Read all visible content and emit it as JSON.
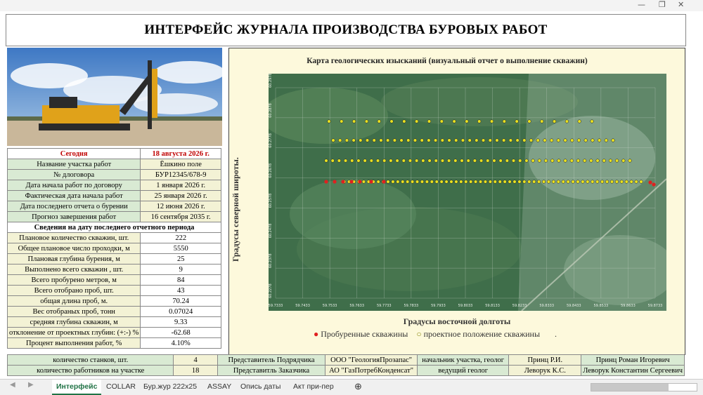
{
  "window": {
    "min": "—",
    "restore": "❐",
    "close": "✕"
  },
  "title": "ИНТЕРФЕЙС ЖУРНАЛА ПРОИЗВОДСТВА БУРОВЫХ РАБОТ",
  "info": {
    "today_label": "Сегодня",
    "today_value": "18 августа 2026 г.",
    "rows": [
      {
        "label": "Название участка работ",
        "value": "Ёшкино поле"
      },
      {
        "label": "№ длоговора",
        "value": "БУР12345/678-9"
      },
      {
        "label": "Дата начала работ по договору",
        "value": "1 января 2026 г."
      },
      {
        "label": "Фактическая дата начала работ",
        "value": "25 января 2026 г."
      },
      {
        "label": "Дата последнего отчета о  бурении",
        "value": "12 июня 2026 г."
      },
      {
        "label": "Прогноз завершения работ",
        "value": "16 сентября 2035 г."
      }
    ],
    "section": "Сведения на дату последнего отчетного периода",
    "stats": [
      {
        "label": "Плановое количество скважин, шт.",
        "value": "222"
      },
      {
        "label": "Общее плановое число проходки, м",
        "value": "5550"
      },
      {
        "label": "Плановая глубина бурения, м",
        "value": "25"
      },
      {
        "label": "Выполнено всего скважин , шт.",
        "value": "9"
      },
      {
        "label": "Всего пробурено метров, м",
        "value": "84"
      },
      {
        "label": "Всего отобрано проб, шт.",
        "value": "43"
      },
      {
        "label": "общая длина проб, м.",
        "value": "70.24"
      },
      {
        "label": "Вес отобраных проб, тонн",
        "value": "0.07024"
      },
      {
        "label": "средняя глубина скважин, м",
        "value": "9.33"
      },
      {
        "label": "отклонение от проектных глубин: (+:-) %",
        "value": "-62.68"
      },
      {
        "label": "Процент выполнения работ, %",
        "value": "4.10%"
      }
    ]
  },
  "map": {
    "title": "Карта геологических изысканий  (визуальный отчет о выполнение скважин)",
    "ylabel": "Градусы северной широты.",
    "xlabel": "Градусы восточной долготы",
    "legend_drilled": "Пробуренные скважины",
    "legend_project": "проектное положение скважины",
    "legend_extra": ".",
    "colors": {
      "drilled": "#e02020",
      "project": "#e8e020"
    }
  },
  "chart_data": {
    "type": "scatter",
    "xlabel": "Градусы восточной долготы",
    "ylabel": "Градусы северной широты.",
    "x_ticks": [
      "59.7333",
      "59.7433",
      "59.7533",
      "59.7633",
      "59.7733",
      "59.7833",
      "59.7933",
      "59.8033",
      "59.8133",
      "59.8233",
      "59.8333",
      "59.8433",
      "59.8533",
      "59.8633",
      "59.8733"
    ],
    "y_ticks": [
      "60.2978",
      "60.2878",
      "60.2778",
      "60.2678",
      "60.2578",
      "60.2478",
      "60.2378",
      "60.2278"
    ],
    "series": [
      {
        "name": "Пробуренные скважины",
        "color": "#e02020",
        "count": 9
      },
      {
        "name": "проектное положение скважины",
        "color": "#e8e020",
        "count": 222
      }
    ]
  },
  "bottom": {
    "row1": [
      "количество станков, шт.",
      "4",
      "Представитель Подрядчика",
      "ООО \"ГеологияПрозапас\"",
      "начальник участка, геолог",
      "Принц Р.И.",
      "Принц Роман Игоревич"
    ],
    "row2": [
      "количество работников на участке",
      "18",
      "Представитль Заказчика",
      "АО \"ГазПотребКонденсат\"",
      "ведущий геолог",
      "Леворук К.С.",
      "Леворук Константин Сергеевич"
    ]
  },
  "tabs": [
    "Интерфейс",
    "COLLAR",
    "Бур.жур 222x25",
    "ASSAY",
    "Опись даты",
    "Акт при-пер"
  ],
  "tabs_add": "⊕"
}
